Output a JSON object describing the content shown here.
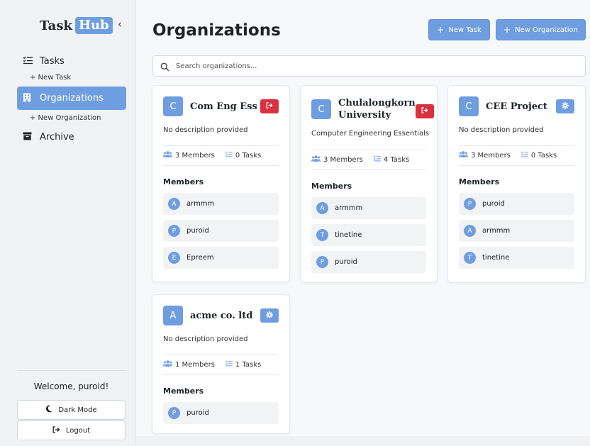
{
  "brand": {
    "part1": "Task",
    "part2": "Hub"
  },
  "sidebar": {
    "collapse": "‹",
    "nav": {
      "tasks": "Tasks",
      "new_task": "+ New Task",
      "organizations": "Organizations",
      "new_organization": "+ New Organization",
      "archive": "Archive"
    },
    "welcome": "Welcome, puroid!",
    "dark_mode": "Dark Mode",
    "logout": "Logout"
  },
  "header": {
    "title": "Organizations",
    "new_task": "New Task",
    "new_organization": "New Organization"
  },
  "search": {
    "placeholder": "Search organizations..."
  },
  "members_heading": "Members",
  "orgs": [
    {
      "initial": "C",
      "name": "Com Eng Ess",
      "action": "leave",
      "description": "No description provided",
      "members": "3 Members",
      "tasks": "0 Tasks",
      "member_list": [
        {
          "initial": "A",
          "name": "armmm"
        },
        {
          "initial": "P",
          "name": "puroid"
        },
        {
          "initial": "E",
          "name": "Epreem"
        }
      ]
    },
    {
      "initial": "C",
      "name": "Chulalongkorn University",
      "action": "leave",
      "description": "Computer Engineering Essentials",
      "members": "3 Members",
      "tasks": "4 Tasks",
      "member_list": [
        {
          "initial": "A",
          "name": "armmm"
        },
        {
          "initial": "T",
          "name": "tinetine"
        },
        {
          "initial": "P",
          "name": "puroid"
        }
      ]
    },
    {
      "initial": "C",
      "name": "CEE Project",
      "action": "settings",
      "description": "No description provided",
      "members": "3 Members",
      "tasks": "0 Tasks",
      "member_list": [
        {
          "initial": "P",
          "name": "puroid"
        },
        {
          "initial": "A",
          "name": "armmm"
        },
        {
          "initial": "T",
          "name": "tinetine"
        }
      ]
    },
    {
      "initial": "A",
      "name": "acme co. ltd",
      "action": "settings",
      "description": "No description provided",
      "members": "1 Members",
      "tasks": "1 Tasks",
      "member_list": [
        {
          "initial": "P",
          "name": "puroid"
        }
      ]
    }
  ],
  "colors": {
    "accent": "#6f9ee0",
    "danger": "#d9313f"
  }
}
